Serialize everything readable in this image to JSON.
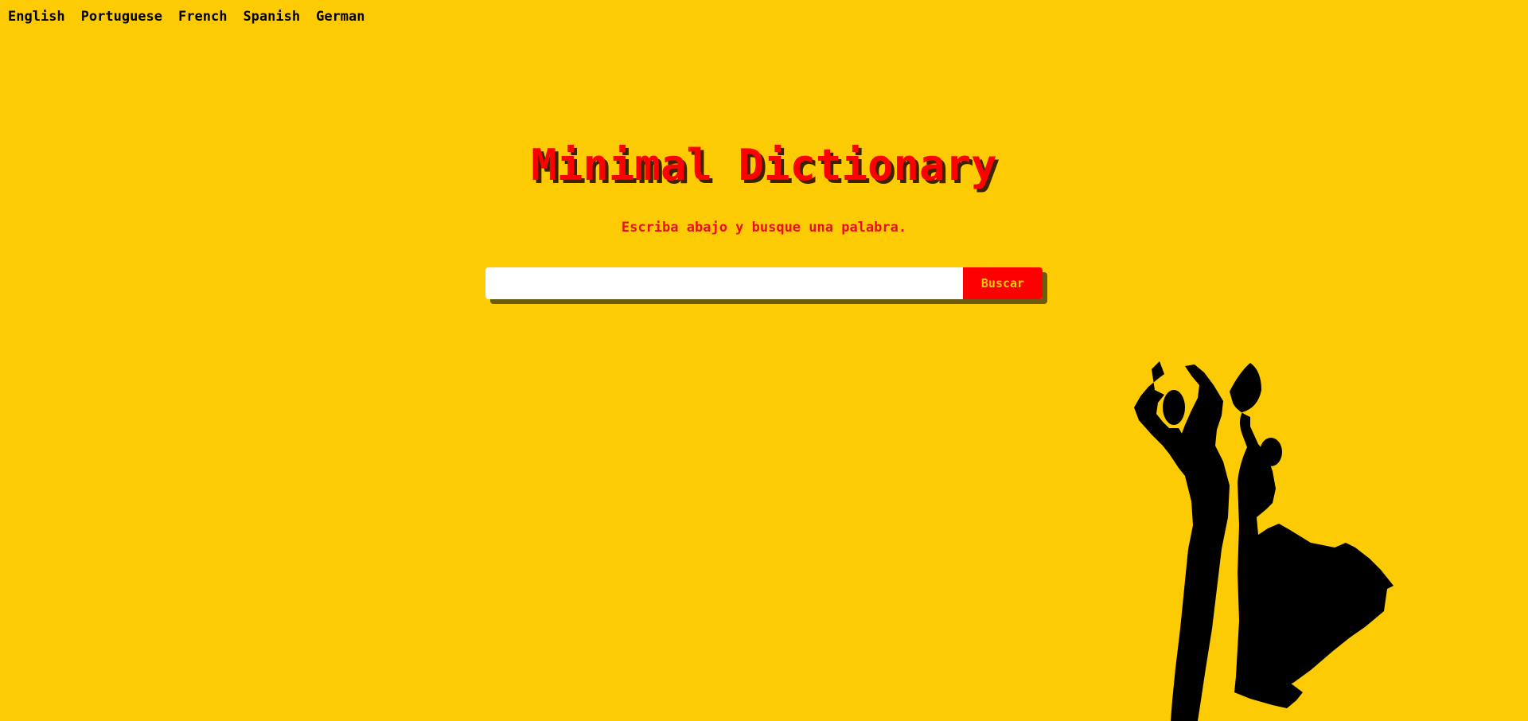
{
  "nav": {
    "languages": [
      "English",
      "Portuguese",
      "French",
      "Spanish",
      "German"
    ]
  },
  "hero": {
    "title": "Minimal Dictionary",
    "subtitle": "Escriba abajo y busque una palabra."
  },
  "search": {
    "value": "",
    "placeholder": "",
    "button_label": "Buscar"
  },
  "illustration": {
    "name": "flamenco-dancers-silhouette",
    "color": "#000000"
  },
  "colors": {
    "background": "#fccb04",
    "accent": "#ff0000",
    "title_shadow": "#3b2300",
    "search_shadow": "#6b5b10"
  }
}
